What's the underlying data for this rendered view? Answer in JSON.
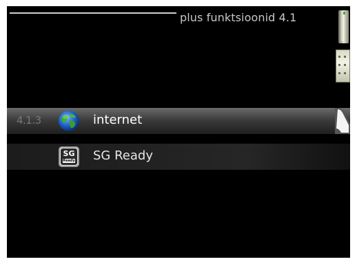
{
  "header": {
    "title": "plus funktsioonid 4.1"
  },
  "menu": {
    "items": [
      {
        "number": "4.1.3",
        "label": "internet",
        "icon": "globe-icon",
        "selected": true
      },
      {
        "number": "",
        "label": "SG Ready",
        "icon": "sg-ready-icon",
        "icon_text_top": "SG",
        "icon_text_bottom": "Ready",
        "selected": false
      }
    ]
  },
  "colors": {
    "background": "#000000",
    "selected_row": "#4a4a4a",
    "text": "#ffffff",
    "title": "#c8c8c8"
  }
}
